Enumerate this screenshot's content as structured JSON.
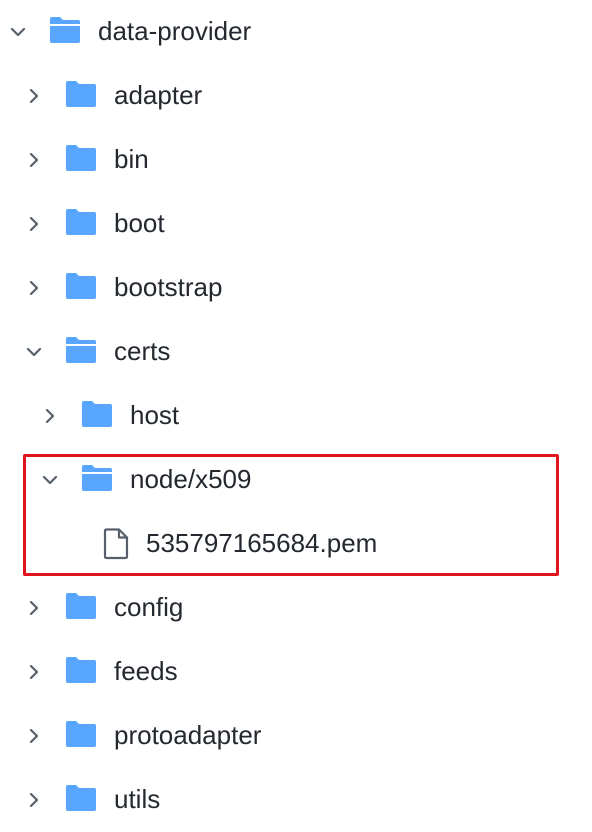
{
  "tree": {
    "root": {
      "label": "data-provider"
    },
    "adapter": {
      "label": "adapter"
    },
    "bin": {
      "label": "bin"
    },
    "boot": {
      "label": "boot"
    },
    "bootstrap": {
      "label": "bootstrap"
    },
    "certs": {
      "label": "certs"
    },
    "host": {
      "label": "host"
    },
    "node_x509": {
      "label": "node/x509"
    },
    "pem_file": {
      "label": "535797165684.pem"
    },
    "config": {
      "label": "config"
    },
    "feeds": {
      "label": "feeds"
    },
    "protoadapter": {
      "label": "protoadapter"
    },
    "utils": {
      "label": "utils"
    }
  },
  "colors": {
    "folder": "#58a6ff",
    "chevron": "#57606a",
    "text": "#24292f",
    "highlight_border": "#e0141e"
  },
  "icons": {
    "folder_closed": "folder-icon",
    "folder_open": "folder-open-icon",
    "file": "file-icon",
    "chevron_right": "chevron-right-icon",
    "chevron_down": "chevron-down-icon"
  }
}
